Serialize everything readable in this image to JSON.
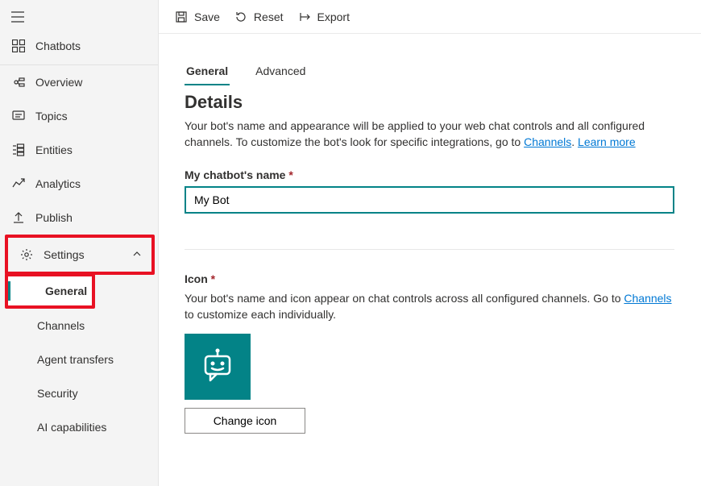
{
  "sidebar": {
    "chatbots_label": "Chatbots",
    "items": [
      {
        "label": "Overview"
      },
      {
        "label": "Topics"
      },
      {
        "label": "Entities"
      },
      {
        "label": "Analytics"
      },
      {
        "label": "Publish"
      }
    ],
    "settings_label": "Settings",
    "settings_children": [
      {
        "label": "General"
      },
      {
        "label": "Channels"
      },
      {
        "label": "Agent transfers"
      },
      {
        "label": "Security"
      },
      {
        "label": "AI capabilities"
      }
    ]
  },
  "toolbar": {
    "save_label": "Save",
    "reset_label": "Reset",
    "export_label": "Export"
  },
  "tabs": {
    "general": "General",
    "advanced": "Advanced"
  },
  "details": {
    "heading": "Details",
    "desc_pre": "Your bot's name and appearance will be applied to your web chat controls and all configured channels. To customize the bot's look for specific integrations, go to ",
    "channels_link": "Channels",
    "period": ". ",
    "learn_more": "Learn more",
    "name_label": "My chatbot's name ",
    "name_value": "My Bot",
    "icon_label": "Icon ",
    "icon_desc_pre": "Your bot's name and icon appear on chat controls across all configured channels. Go to ",
    "icon_desc_post": " to customize each individually.",
    "change_icon": "Change icon"
  }
}
